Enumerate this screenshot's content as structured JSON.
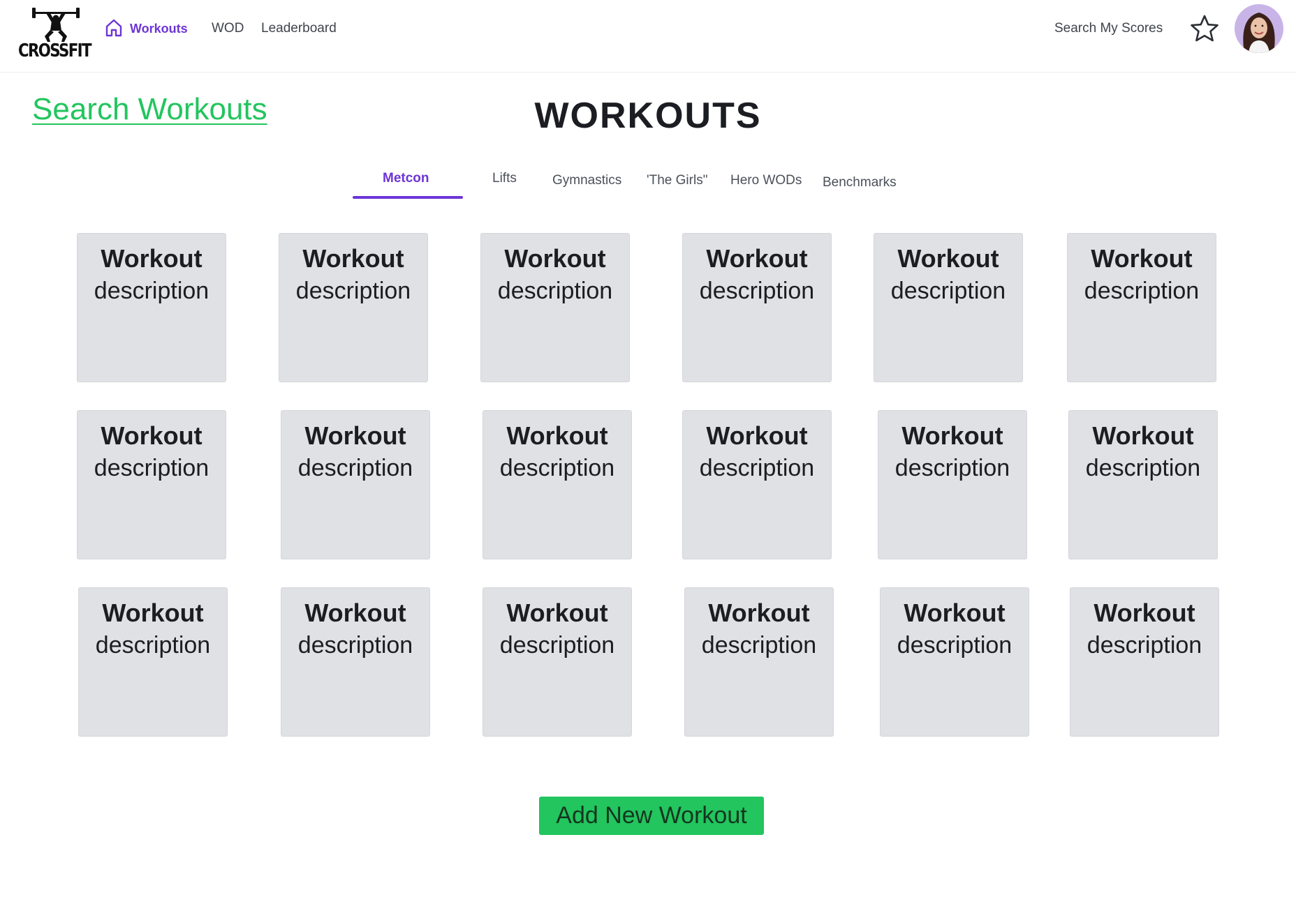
{
  "brand": {
    "logo_text": "CROSSFIT"
  },
  "nav": {
    "items": [
      {
        "label": "Workouts",
        "active": true,
        "icon": "home-icon"
      },
      {
        "label": "WOD",
        "active": false
      },
      {
        "label": "Leaderboard",
        "active": false
      }
    ],
    "search_scores": "Search My Scores",
    "accent_color": "#6d35d6"
  },
  "page": {
    "search_link": "Search Workouts",
    "title": "WORKOUTS",
    "link_color": "#22c55e"
  },
  "tabs": [
    {
      "label": "Metcon",
      "active": true
    },
    {
      "label": "Lifts",
      "active": false
    },
    {
      "label": "Gymnastics",
      "active": false
    },
    {
      "label": "'The Girls\"",
      "active": false
    },
    {
      "label": "Hero WODs",
      "active": false
    },
    {
      "label": "Benchmarks",
      "active": false
    }
  ],
  "cards": [
    {
      "title": "Workout",
      "description": "description"
    },
    {
      "title": "Workout",
      "description": "description"
    },
    {
      "title": "Workout",
      "description": "description"
    },
    {
      "title": "Workout",
      "description": "description"
    },
    {
      "title": "Workout",
      "description": "description"
    },
    {
      "title": "Workout",
      "description": "description"
    },
    {
      "title": "Workout",
      "description": "description"
    },
    {
      "title": "Workout",
      "description": "description"
    },
    {
      "title": "Workout",
      "description": "description"
    },
    {
      "title": "Workout",
      "description": "description"
    },
    {
      "title": "Workout",
      "description": "description"
    },
    {
      "title": "Workout",
      "description": "description"
    },
    {
      "title": "Workout",
      "description": "description"
    },
    {
      "title": "Workout",
      "description": "description"
    },
    {
      "title": "Workout",
      "description": "description"
    },
    {
      "title": "Workout",
      "description": "description"
    },
    {
      "title": "Workout",
      "description": "description"
    },
    {
      "title": "Workout",
      "description": "description"
    }
  ],
  "actions": {
    "add_workout": "Add New Workout",
    "button_color": "#22c55e"
  }
}
